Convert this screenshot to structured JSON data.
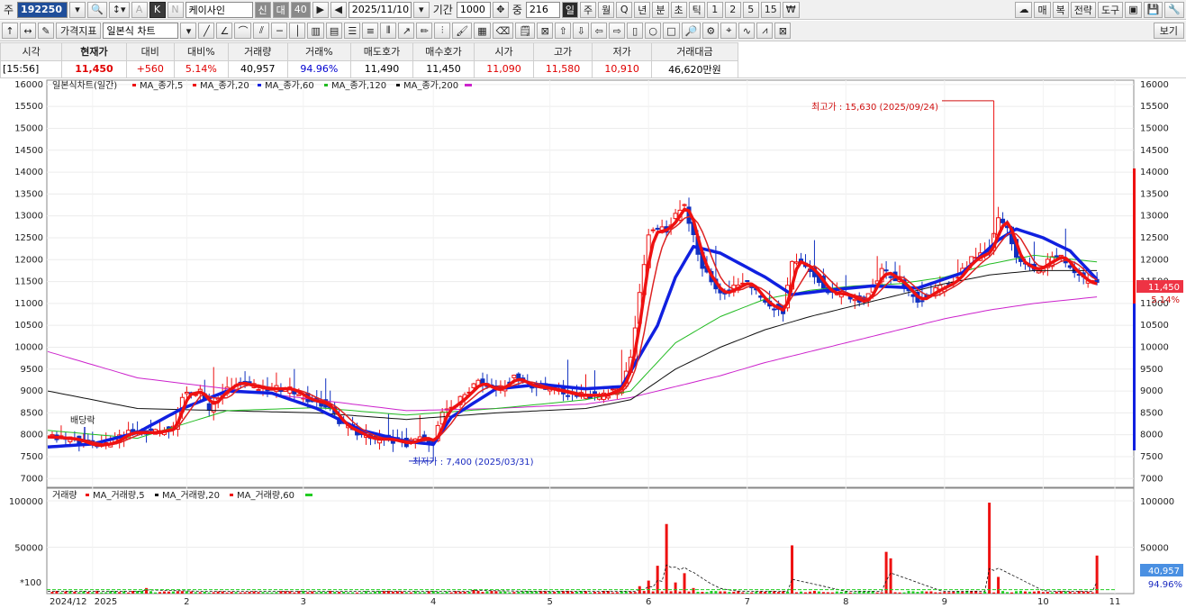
{
  "toolbar1": {
    "code_prefix": "주",
    "code": "192250",
    "mode_k": "K",
    "mode_a": "A",
    "mode_n": "N",
    "stock_name": "케이사인",
    "tag_shin": "신",
    "tag_dae": "대",
    "tag_40": "40",
    "date": "2025/11/10",
    "period_label": "기간",
    "period_value": "1000",
    "count_label": "중",
    "count_value": "216",
    "periods": [
      "일",
      "주",
      "월",
      "Q",
      "년",
      "분",
      "초",
      "틱",
      "1",
      "2",
      "5",
      "15",
      "₩"
    ],
    "right_buttons": [
      "매",
      "복",
      "전략",
      "도구"
    ]
  },
  "toolbar2": {
    "indicator_button": "가격지표",
    "chart_type": "일본식 차트",
    "view_button": "보기"
  },
  "quote": {
    "headers": [
      "시각",
      "현재가",
      "대비",
      "대비%",
      "거래량",
      "거래%",
      "매도호가",
      "매수호가",
      "시가",
      "고가",
      "저가",
      "거래대금"
    ],
    "values": [
      "[15:56]",
      "11,450",
      "+560",
      "5.14%",
      "40,957",
      "94.96%",
      "11,490",
      "11,450",
      "11,090",
      "11,580",
      "10,910",
      "46,620만원"
    ]
  },
  "legend": {
    "main_title": "일본식차트(일간)",
    "ma": [
      {
        "name": "MA_종가,5",
        "color": "#ee1111"
      },
      {
        "name": "MA_종가,20",
        "color": "#ee1111"
      },
      {
        "name": "MA_종가,60",
        "color": "#1020e0"
      },
      {
        "name": "MA_종가,120",
        "color": "#22bb22"
      },
      {
        "name": "MA_종가,200",
        "color": "#cc22cc"
      }
    ],
    "volume_title": "거래량",
    "vol_ma": [
      {
        "name": "MA_거래량,5",
        "color": "#ee1111"
      },
      {
        "name": "MA_거래량,20",
        "color": "#111111"
      },
      {
        "name": "MA_거래량,60",
        "color": "#ee1111"
      },
      {
        "name": "",
        "color": "#22cc22"
      }
    ]
  },
  "annotations": {
    "high": "최고가 : 15,630 (2025/09/24)",
    "low": "최저가 : 7,400 (2025/03/31)",
    "dividend": "배당락"
  },
  "price_badge": {
    "price": "11,450",
    "pct": "5.14%"
  },
  "volume_badge": {
    "value": "40,957",
    "pct": "94.96%"
  },
  "volume_unit": "*100",
  "chart_data": {
    "type": "candlestick",
    "y_ticks": [
      7000,
      7500,
      8000,
      8500,
      9000,
      9500,
      10000,
      10500,
      11000,
      11500,
      12000,
      12500,
      13000,
      13500,
      14000,
      14500,
      15000,
      15500,
      16000
    ],
    "y_range": [
      6800,
      16100
    ],
    "vol_ticks": [
      50000,
      100000
    ],
    "vol_range": [
      0,
      100000
    ],
    "x_labels": [
      "2024/12",
      "2025",
      "2",
      "3",
      "4",
      "5",
      "6",
      "7",
      "8",
      "9",
      "10",
      "11"
    ],
    "close_path": [
      [
        0,
        7950
      ],
      [
        6,
        7900
      ],
      [
        10,
        7750
      ],
      [
        14,
        7800
      ],
      [
        18,
        8050
      ],
      [
        24,
        8050
      ],
      [
        28,
        8150
      ],
      [
        30,
        8900
      ],
      [
        34,
        9000
      ],
      [
        36,
        8600
      ],
      [
        38,
        8900
      ],
      [
        42,
        9200
      ],
      [
        48,
        9050
      ],
      [
        54,
        9050
      ],
      [
        58,
        8800
      ],
      [
        62,
        8700
      ],
      [
        66,
        8200
      ],
      [
        72,
        7900
      ],
      [
        76,
        7900
      ],
      [
        80,
        7800
      ],
      [
        84,
        7950
      ],
      [
        86,
        7800
      ],
      [
        88,
        8500
      ],
      [
        92,
        8800
      ],
      [
        96,
        9200
      ],
      [
        100,
        9000
      ],
      [
        104,
        9300
      ],
      [
        108,
        9100
      ],
      [
        112,
        9050
      ],
      [
        118,
        8900
      ],
      [
        124,
        8900
      ],
      [
        128,
        9100
      ],
      [
        130,
        9800
      ],
      [
        134,
        12600
      ],
      [
        138,
        12700
      ],
      [
        142,
        13300
      ],
      [
        144,
        12500
      ],
      [
        146,
        11800
      ],
      [
        150,
        11200
      ],
      [
        156,
        11500
      ],
      [
        160,
        11000
      ],
      [
        164,
        10800
      ],
      [
        166,
        12000
      ],
      [
        170,
        11800
      ],
      [
        174,
        11250
      ],
      [
        178,
        11200
      ],
      [
        182,
        11000
      ],
      [
        186,
        11750
      ],
      [
        190,
        11500
      ],
      [
        194,
        11050
      ],
      [
        198,
        11300
      ],
      [
        202,
        11500
      ],
      [
        206,
        12000
      ],
      [
        210,
        12200
      ],
      [
        212,
        12900
      ],
      [
        214,
        12800
      ],
      [
        216,
        12000
      ],
      [
        220,
        11750
      ],
      [
        224,
        12000
      ],
      [
        226,
        12100
      ],
      [
        228,
        11800
      ],
      [
        232,
        11450
      ],
      [
        234,
        11450
      ]
    ],
    "ma60_path": [
      [
        0,
        7720
      ],
      [
        10,
        7790
      ],
      [
        20,
        8050
      ],
      [
        30,
        8600
      ],
      [
        40,
        9000
      ],
      [
        50,
        8950
      ],
      [
        60,
        8600
      ],
      [
        70,
        8100
      ],
      [
        80,
        7850
      ],
      [
        86,
        7780
      ],
      [
        90,
        8400
      ],
      [
        100,
        9050
      ],
      [
        110,
        9150
      ],
      [
        120,
        9050
      ],
      [
        128,
        9100
      ],
      [
        136,
        10500
      ],
      [
        140,
        11600
      ],
      [
        144,
        12300
      ],
      [
        150,
        12150
      ],
      [
        160,
        11600
      ],
      [
        166,
        11200
      ],
      [
        174,
        11300
      ],
      [
        184,
        11400
      ],
      [
        194,
        11350
      ],
      [
        204,
        11700
      ],
      [
        212,
        12450
      ],
      [
        216,
        12700
      ],
      [
        222,
        12500
      ],
      [
        228,
        12200
      ],
      [
        234,
        11550
      ]
    ],
    "ma120_path": [
      [
        0,
        8100
      ],
      [
        20,
        7920
      ],
      [
        40,
        8550
      ],
      [
        60,
        8620
      ],
      [
        80,
        8450
      ],
      [
        100,
        8600
      ],
      [
        120,
        8800
      ],
      [
        130,
        9000
      ],
      [
        140,
        10100
      ],
      [
        150,
        10700
      ],
      [
        160,
        11100
      ],
      [
        170,
        11300
      ],
      [
        180,
        11400
      ],
      [
        190,
        11450
      ],
      [
        200,
        11600
      ],
      [
        210,
        11900
      ],
      [
        220,
        12100
      ],
      [
        234,
        11950
      ]
    ],
    "ma200_path": [
      [
        0,
        9000
      ],
      [
        20,
        8600
      ],
      [
        40,
        8550
      ],
      [
        60,
        8500
      ],
      [
        80,
        8350
      ],
      [
        100,
        8500
      ],
      [
        120,
        8600
      ],
      [
        130,
        8800
      ],
      [
        140,
        9500
      ],
      [
        150,
        10000
      ],
      [
        160,
        10400
      ],
      [
        170,
        10700
      ],
      [
        180,
        10950
      ],
      [
        190,
        11200
      ],
      [
        200,
        11450
      ],
      [
        210,
        11650
      ],
      [
        220,
        11750
      ],
      [
        234,
        11750
      ]
    ],
    "ma250_path": [
      [
        0,
        9900
      ],
      [
        20,
        9300
      ],
      [
        40,
        9050
      ],
      [
        60,
        8800
      ],
      [
        80,
        8550
      ],
      [
        100,
        8600
      ],
      [
        120,
        8700
      ],
      [
        130,
        8850
      ],
      [
        140,
        9100
      ],
      [
        150,
        9350
      ],
      [
        160,
        9650
      ],
      [
        170,
        9900
      ],
      [
        180,
        10150
      ],
      [
        190,
        10400
      ],
      [
        200,
        10650
      ],
      [
        210,
        10850
      ],
      [
        220,
        11000
      ],
      [
        234,
        11150
      ]
    ],
    "volume_spikes": [
      [
        22,
        6000
      ],
      [
        95,
        4000
      ],
      [
        132,
        8000
      ],
      [
        134,
        14000
      ],
      [
        136,
        30000
      ],
      [
        138,
        75000
      ],
      [
        140,
        12000
      ],
      [
        142,
        22000
      ],
      [
        144,
        6000
      ],
      [
        166,
        52000
      ],
      [
        187,
        45000
      ],
      [
        188,
        38000
      ],
      [
        210,
        98000
      ],
      [
        212,
        18000
      ],
      [
        234,
        41000
      ]
    ],
    "high": {
      "value": 15630,
      "date": "2025/09/24"
    },
    "low": {
      "value": 7400,
      "date": "2025/03/31"
    }
  }
}
